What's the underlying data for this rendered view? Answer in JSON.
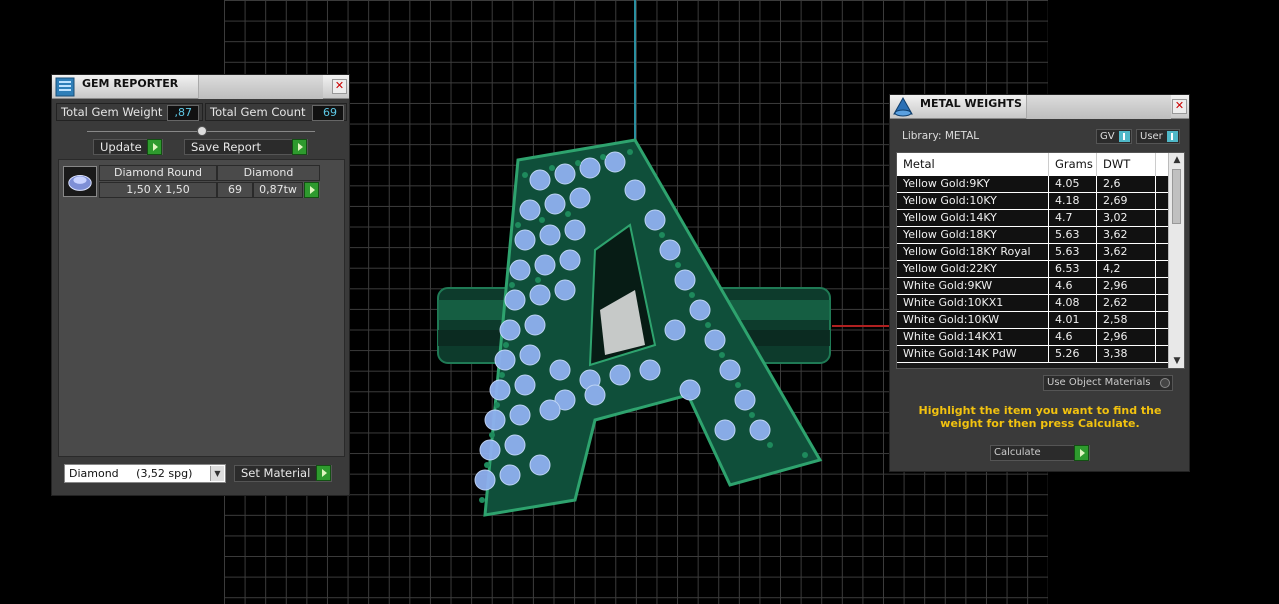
{
  "gem_reporter": {
    "title": "GEM REPORTER",
    "total_weight_label": "Total Gem Weight",
    "total_weight_value": ",87",
    "total_count_label": "Total Gem Count",
    "total_count_value": "69",
    "update_label": "Update",
    "save_report_label": "Save Report",
    "gems": [
      {
        "shape": "Diamond Round",
        "size": "1,50 X 1,50",
        "material": "Diamond",
        "count": "69",
        "weight": "0,87tw"
      }
    ],
    "material_select": "Diamond     (3,52 spg)",
    "set_material_label": "Set Material"
  },
  "metal_weights": {
    "title": "METAL WEIGHTS",
    "library_label": "Library: METAL",
    "gv_label": "GV",
    "user_label": "User",
    "columns": [
      "Metal",
      "Grams",
      "DWT"
    ],
    "rows": [
      [
        "Yellow Gold:9KY",
        "4.05",
        "2,6"
      ],
      [
        "Yellow Gold:10KY",
        "4.18",
        "2,69"
      ],
      [
        "Yellow Gold:14KY",
        "4.7",
        "3,02"
      ],
      [
        "Yellow Gold:18KY",
        "5.63",
        "3,62"
      ],
      [
        "Yellow Gold:18KY Royal",
        "5.63",
        "3,62"
      ],
      [
        "Yellow Gold:22KY",
        "6.53",
        "4,2"
      ],
      [
        "White Gold:9KW",
        "4.6",
        "2,96"
      ],
      [
        "White Gold:10KX1",
        "4.08",
        "2,62"
      ],
      [
        "White Gold:10KW",
        "4.01",
        "2,58"
      ],
      [
        "White Gold:14KX1",
        "4.6",
        "2,96"
      ],
      [
        "White Gold:14K PdW",
        "5.26",
        "3,38"
      ]
    ],
    "use_object_materials_label": "Use Object Materials",
    "hint": "Highlight the item you want to find the weight for then press Calculate.",
    "calculate_label": "Calculate"
  },
  "colors": {
    "hint": "#f2c20f",
    "accent_green": "#2e9a2e",
    "value_cyan": "#5ec9e6"
  }
}
